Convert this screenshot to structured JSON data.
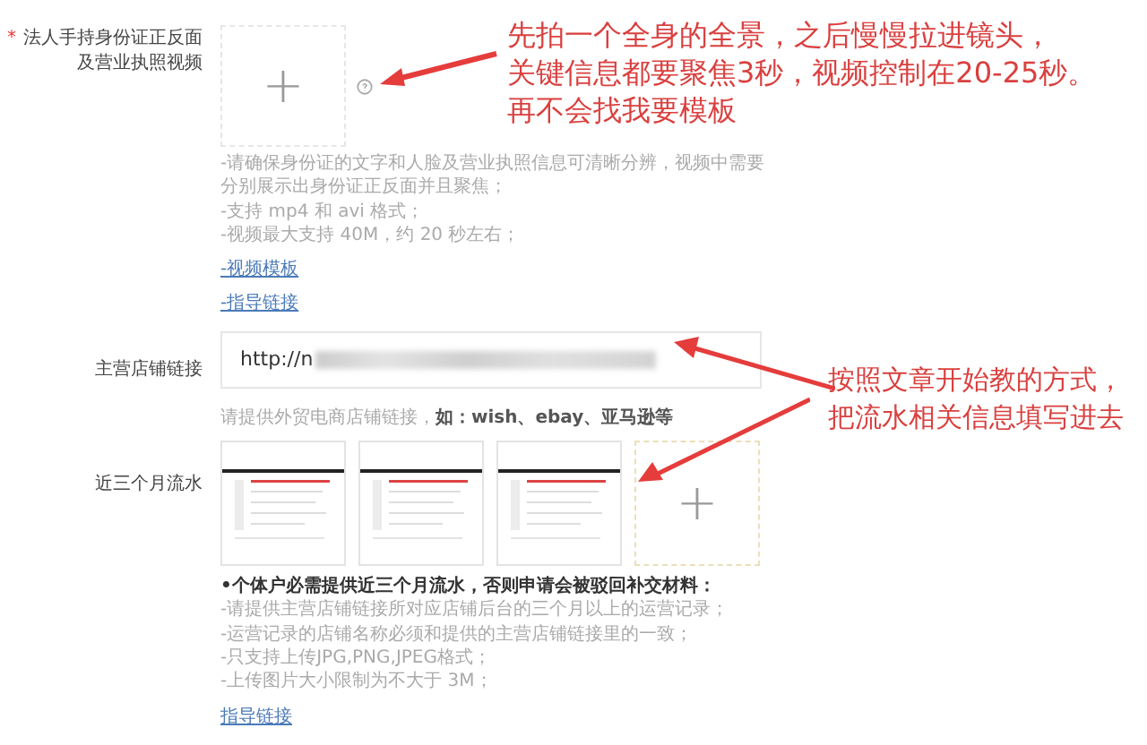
{
  "sections": [
    {
      "kind": "video",
      "label": "法人手持身份证正反面及营业执照视频",
      "required_mark": "*",
      "upload": {
        "symbol": "+"
      },
      "hints": [
        "-请确保身份证的文字和人脸及营业执照信息可清晰分辨，视频中需要分别展示出身份证正反面并且聚焦；",
        "-支持 mp4 和 avi 格式；",
        "-视频最大支持 40M，约 20 秒左右；"
      ],
      "links": [
        "-视频模板",
        "-指导链接"
      ]
    },
    {
      "kind": "url",
      "label": "主营店铺链接",
      "value": "http://n",
      "hints": [
        "请提供外贸电商店铺链接，**如：wish、ebay、亚马逊等**"
      ]
    },
    {
      "kind": "images",
      "label": "近三个月流水",
      "thumbnails": [
        {
          "kind": "picture"
        },
        {
          "kind": "picture"
        },
        {
          "kind": "picture"
        }
      ],
      "upload": {
        "symbol": "+"
      },
      "notice": "•个体户必需提供近三个月流水，否则申请会被驳回补交材料：",
      "hints": [
        "-请提供主营店铺链接所对应店铺后台的三个月以上的运营记录；",
        "-运营记录的店铺名称必须和提供的主营店铺链接里的一致；",
        "-只支持上传JPG,PNG,JPEG格式；",
        "-上传图片大小限制为不大于 3M；"
      ],
      "links": [
        "指导链接"
      ]
    }
  ],
  "annotations": [
    {
      "lines": [
        "先拍一个全身的全景，之后慢慢拉进镜头，",
        "关键信息都要聚焦3秒，视频控制在20-25秒。",
        "再不会找我要模板"
      ]
    },
    {
      "lines": [
        "按照文章开始教的方式，",
        "把流水相关信息填写进去"
      ]
    }
  ]
}
